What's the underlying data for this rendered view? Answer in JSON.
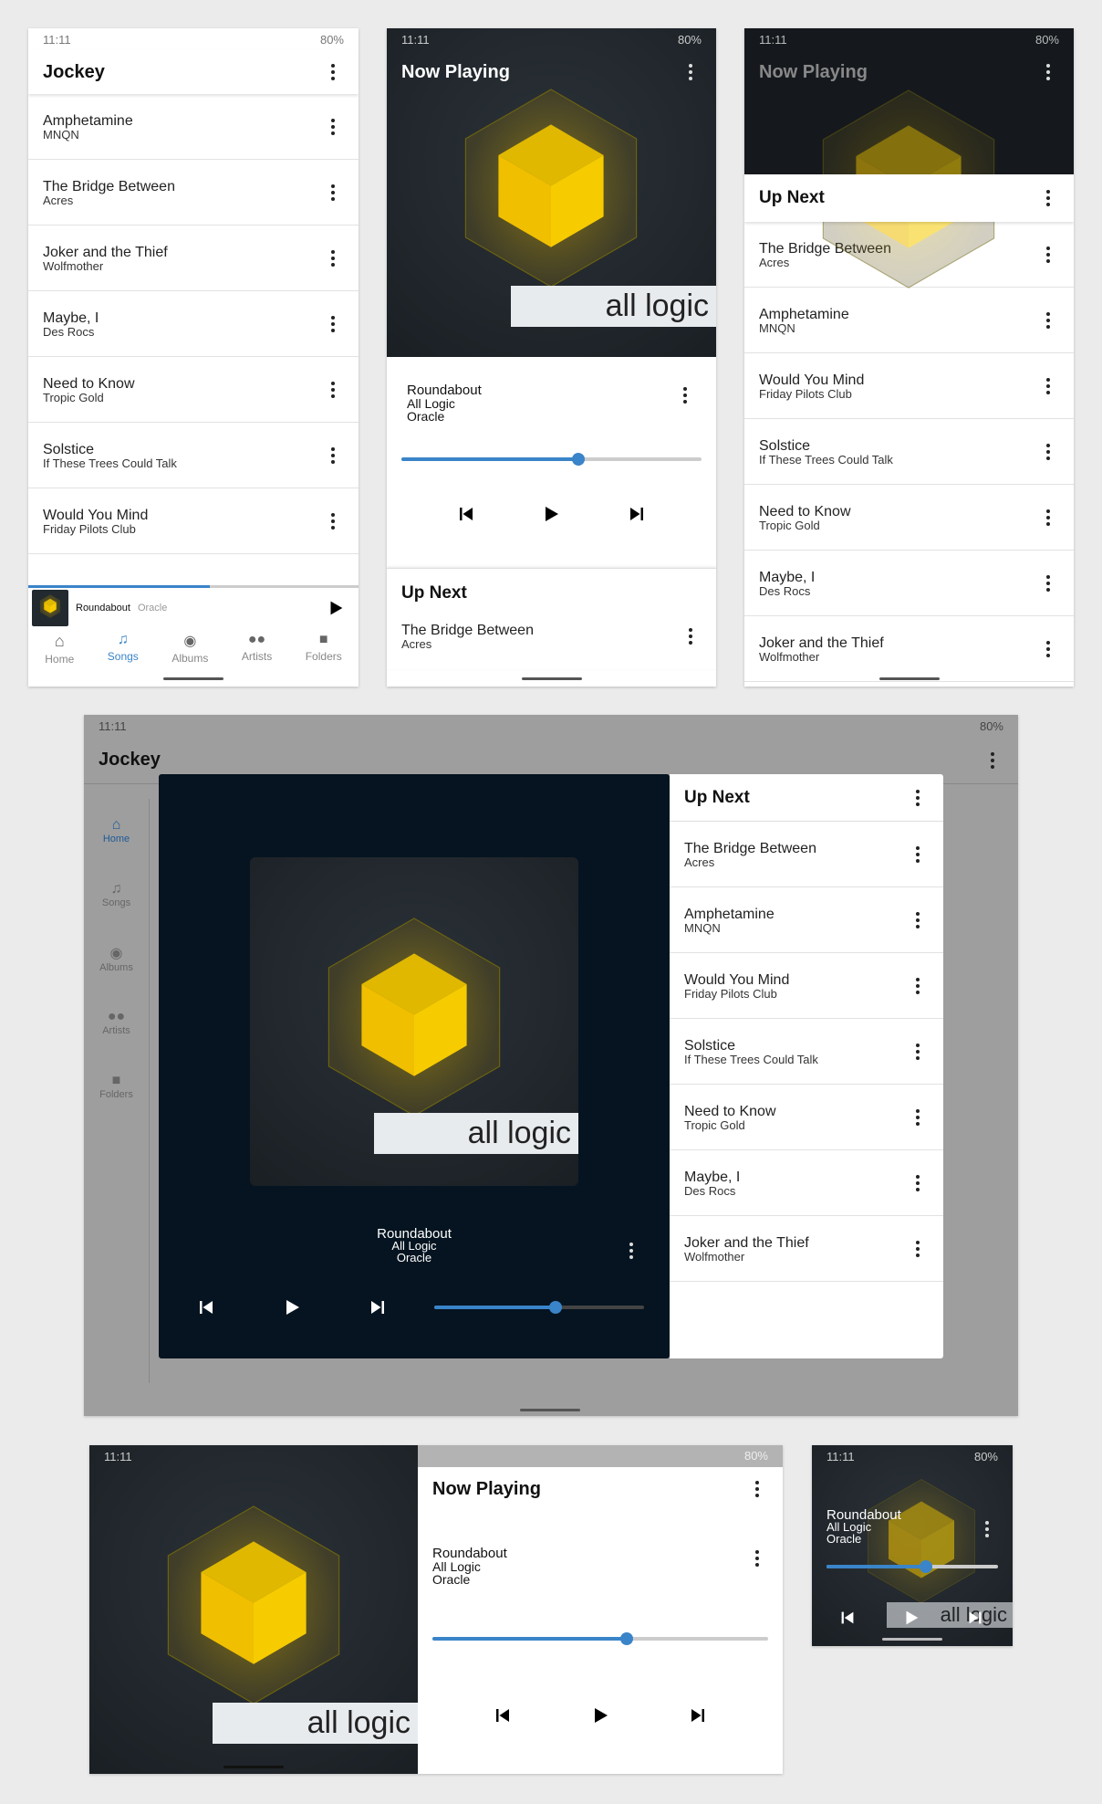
{
  "status": {
    "time": "11:11",
    "battery": "80%"
  },
  "songs_screen": {
    "title": "Jockey",
    "songs": [
      {
        "title": "Amphetamine",
        "artist": "MNQN"
      },
      {
        "title": "The Bridge Between",
        "artist": "Acres"
      },
      {
        "title": "Joker and the Thief",
        "artist": "Wolfmother"
      },
      {
        "title": "Maybe, I",
        "artist": "Des Rocs"
      },
      {
        "title": "Need to Know",
        "artist": "Tropic Gold"
      },
      {
        "title": "Solstice",
        "artist": "If These Trees Could Talk"
      },
      {
        "title": "Would You Mind",
        "artist": "Friday Pilots Club"
      }
    ],
    "mini_player": {
      "title": "Roundabout",
      "artist": "Oracle",
      "progress": 0.55
    },
    "nav": [
      {
        "label": "Home",
        "icon": "home-icon"
      },
      {
        "label": "Songs",
        "icon": "songs-icon",
        "active": true
      },
      {
        "label": "Albums",
        "icon": "album-icon"
      },
      {
        "label": "Artists",
        "icon": "artists-icon"
      },
      {
        "label": "Folders",
        "icon": "folder-icon"
      }
    ]
  },
  "now_playing": {
    "title": "Now Playing",
    "album_label": "all logic",
    "song": "Roundabout",
    "album": "All Logic",
    "artist": "Oracle",
    "progress": 0.59
  },
  "up_next": {
    "title": "Up Next",
    "items": [
      {
        "title": "The Bridge Between",
        "artist": "Acres"
      },
      {
        "title": "Amphetamine",
        "artist": "MNQN"
      },
      {
        "title": "Would You Mind",
        "artist": "Friday Pilots Club"
      },
      {
        "title": "Solstice",
        "artist": "If These Trees Could Talk"
      },
      {
        "title": "Need to Know",
        "artist": "Tropic Gold"
      },
      {
        "title": "Maybe, I",
        "artist": "Des Rocs"
      },
      {
        "title": "Joker and the Thief",
        "artist": "Wolfmother"
      }
    ]
  },
  "tablet": {
    "title": "Jockey",
    "nav": [
      "Home",
      "Songs",
      "Albums",
      "Artists",
      "Folders"
    ],
    "progress": 0.58
  },
  "colors": {
    "accent": "#3a84c9",
    "cube": "#f5c800",
    "dark_bg": "#1d2328"
  }
}
